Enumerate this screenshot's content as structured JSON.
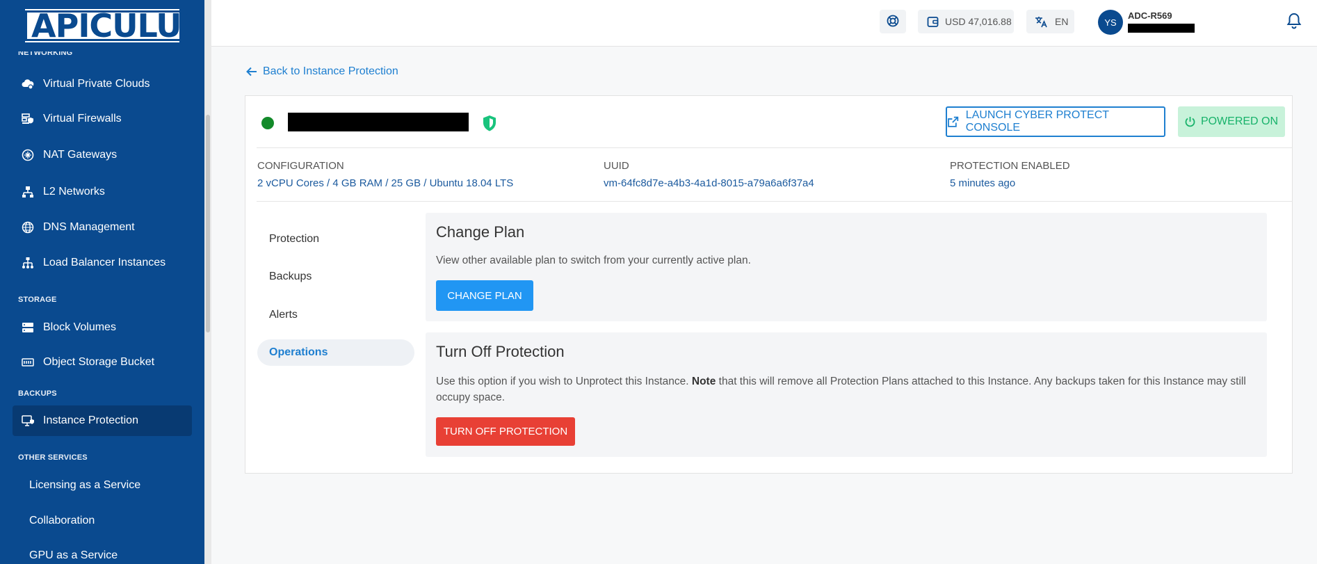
{
  "brand": {
    "logo_text": "APICULUS",
    "accent": "#0a4a8f"
  },
  "sidebar": {
    "cut_header": "NETWORKING",
    "items": [
      {
        "label": "Virtual Private Clouds",
        "icon": "cloud-network-icon"
      },
      {
        "label": "Virtual Firewalls",
        "icon": "firewall-icon"
      },
      {
        "label": "NAT Gateways",
        "icon": "nat-gateway-icon"
      },
      {
        "label": "L2 Networks",
        "icon": "network-tree-icon"
      },
      {
        "label": "DNS Management",
        "icon": "globe-icon"
      },
      {
        "label": "Load Balancer Instances",
        "icon": "load-balancer-icon"
      }
    ],
    "storage_label": "STORAGE",
    "storage_items": [
      {
        "label": "Block Volumes",
        "icon": "block-volume-icon"
      },
      {
        "label": "Object Storage Bucket",
        "icon": "bucket-icon"
      }
    ],
    "backups_label": "BACKUPS",
    "backups_items": [
      {
        "label": "Instance Protection",
        "icon": "monitor-shield-icon",
        "active": true
      }
    ],
    "other_label": "OTHER SERVICES",
    "other_items": [
      {
        "label": "Licensing as a Service"
      },
      {
        "label": "Collaboration"
      },
      {
        "label": "GPU as a Service"
      }
    ]
  },
  "topbar": {
    "support_icon": "lifebuoy-icon",
    "balance": "USD 47,016.88",
    "language": "EN",
    "avatar_initials": "YS",
    "account_name": "ADC-R569",
    "notifications_icon": "bell-icon"
  },
  "main": {
    "back_link": "Back to Instance Protection",
    "instance": {
      "status_color": "#138a2a",
      "launch_button": "LAUNCH CYBER PROTECT CONSOLE",
      "power_status": "POWERED ON",
      "configuration_label": "CONFIGURATION",
      "configuration_value": "2 vCPU Cores / 4 GB RAM / 25 GB / Ubuntu 18.04 LTS",
      "uuid_label": "UUID",
      "uuid_value": "vm-64fc8d7e-a4b3-4a1d-8015-a79a6a6f37a4",
      "protection_label": "PROTECTION ENABLED",
      "protection_value": "5 minutes ago"
    },
    "tabs": [
      {
        "label": "Protection"
      },
      {
        "label": "Backups"
      },
      {
        "label": "Alerts"
      },
      {
        "label": "Operations",
        "active": true
      }
    ],
    "change_plan": {
      "title": "Change Plan",
      "description": "View other available plan to switch from your currently active plan.",
      "button": "CHANGE PLAN"
    },
    "turn_off": {
      "title": "Turn Off Protection",
      "desc_before": "Use this option if you wish to Unprotect this Instance. ",
      "desc_note": "Note",
      "desc_after": " that this will remove all Protection Plans attached to this Instance. Any backups taken for this Instance may still occupy space.",
      "button": "TURN OFF PROTECTION"
    }
  }
}
